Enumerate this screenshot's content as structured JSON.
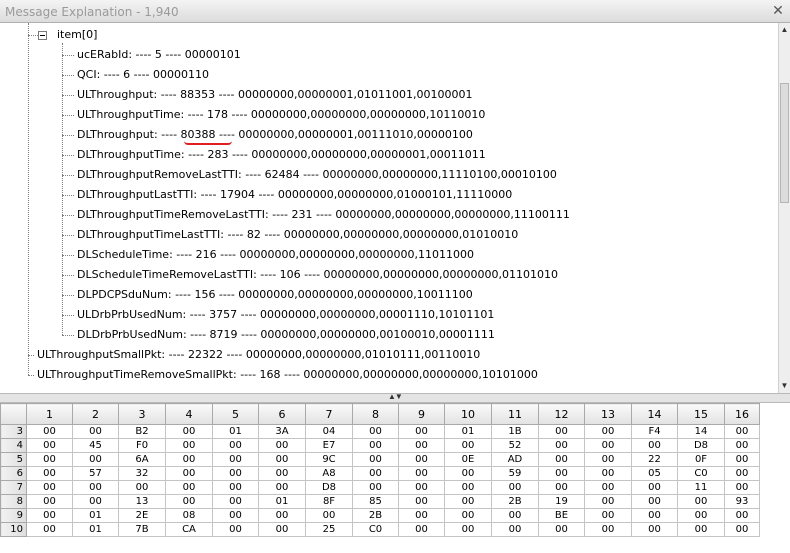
{
  "window": {
    "title": "Message Explanation - 1,940"
  },
  "tree": {
    "parent": "item[0]",
    "children": [
      "ucERabId: ---- 5 ---- 00000101",
      "QCI: ---- 6 ---- 00000110",
      "ULThroughput: ---- 88353 ---- 00000000,00000001,01011001,00100001",
      "ULThroughputTime: ---- 178 ---- 00000000,00000000,00000000,10110010",
      "DLThroughput: ---- 80388 ---- 00000000,00000001,00111010,00000100",
      "DLThroughputTime: ---- 283 ---- 00000000,00000000,00000001,00011011",
      "DLThroughputRemoveLastTTI: ---- 62484 ---- 00000000,00000000,11110100,00010100",
      "DLThroughputLastTTI: ---- 17904 ---- 00000000,00000000,01000101,11110000",
      "DLThroughputTimeRemoveLastTTI: ---- 231 ---- 00000000,00000000,00000000,11100111",
      "DLThroughputTimeLastTTI: ---- 82 ---- 00000000,00000000,00000000,01010010",
      "DLScheduleTime: ---- 216 ---- 00000000,00000000,00000000,11011000",
      "DLScheduleTimeRemoveLastTTI: ---- 106 ---- 00000000,00000000,00000000,01101010",
      "DLPDCPSduNum: ---- 156 ---- 00000000,00000000,00000000,10011100",
      "ULDrbPrbUsedNum: ---- 3757 ---- 00000000,00000000,00001110,10101101",
      "DLDrbPrbUsedNum: ---- 8719 ---- 00000000,00000000,00100010,00001111"
    ],
    "siblings": [
      "ULThroughputSmallPkt: ---- 22322 ---- 00000000,00000000,01010111,00110010",
      "ULThroughputTimeRemoveSmallPkt: ---- 168 ---- 00000000,00000000,00000000,10101000"
    ]
  },
  "hex_grid": {
    "columns": [
      "1",
      "2",
      "3",
      "4",
      "5",
      "6",
      "7",
      "8",
      "9",
      "10",
      "11",
      "12",
      "13",
      "14",
      "15",
      "16"
    ],
    "rows": [
      {
        "num": "3",
        "cells": [
          "00",
          "00",
          "B2",
          "00",
          "01",
          "3A",
          "04",
          "00",
          "00",
          "01",
          "1B",
          "00",
          "00",
          "F4",
          "14",
          "00"
        ]
      },
      {
        "num": "4",
        "cells": [
          "00",
          "45",
          "F0",
          "00",
          "00",
          "00",
          "E7",
          "00",
          "00",
          "00",
          "52",
          "00",
          "00",
          "00",
          "D8",
          "00"
        ]
      },
      {
        "num": "5",
        "cells": [
          "00",
          "00",
          "6A",
          "00",
          "00",
          "00",
          "9C",
          "00",
          "00",
          "0E",
          "AD",
          "00",
          "00",
          "22",
          "0F",
          "00"
        ]
      },
      {
        "num": "6",
        "cells": [
          "00",
          "57",
          "32",
          "00",
          "00",
          "00",
          "A8",
          "00",
          "00",
          "00",
          "59",
          "00",
          "00",
          "05",
          "C0",
          "00"
        ]
      },
      {
        "num": "7",
        "cells": [
          "00",
          "00",
          "00",
          "00",
          "00",
          "00",
          "D8",
          "00",
          "00",
          "00",
          "00",
          "00",
          "00",
          "00",
          "11",
          "00"
        ]
      },
      {
        "num": "8",
        "cells": [
          "00",
          "00",
          "13",
          "00",
          "00",
          "01",
          "8F",
          "85",
          "00",
          "00",
          "2B",
          "19",
          "00",
          "00",
          "00",
          "93"
        ]
      },
      {
        "num": "9",
        "cells": [
          "00",
          "01",
          "2E",
          "08",
          "00",
          "00",
          "00",
          "2B",
          "00",
          "00",
          "00",
          "BE",
          "00",
          "00",
          "00",
          "00"
        ]
      },
      {
        "num": "10",
        "cells": [
          "00",
          "01",
          "7B",
          "CA",
          "00",
          "00",
          "25",
          "C0",
          "00",
          "00",
          "00",
          "00",
          "00",
          "00",
          "00",
          "00"
        ]
      }
    ]
  },
  "colors": {
    "annotation": "#e02020"
  }
}
